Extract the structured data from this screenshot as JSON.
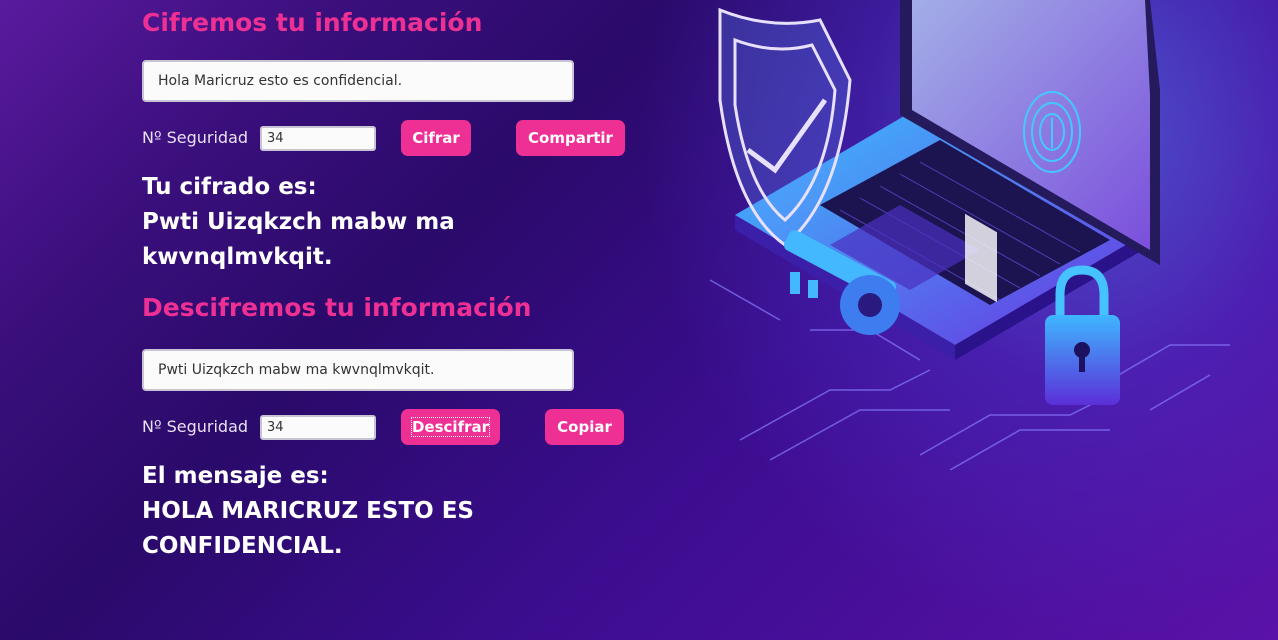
{
  "encrypt": {
    "heading": "Cifremos tu información",
    "message_value": "Hola Maricruz esto es confidencial.",
    "security_label": "Nº Seguridad",
    "security_value": "34",
    "encrypt_button": "Cifrar",
    "share_button": "Compartir",
    "result_title": "Tu cifrado es:",
    "result_text": "Pwti Uizqkzch mabw ma kwvnqlmvkqit."
  },
  "decrypt": {
    "heading": "Descifremos tu información",
    "message_value": "Pwti Uizqkzch mabw ma kwvnqlmvkqit.",
    "security_label": "Nº Seguridad",
    "security_value": "34",
    "decrypt_button": "Descifrar",
    "copy_button": "Copiar",
    "result_title": "El mensaje es:",
    "result_text": "HOLA MARICRUZ ESTO ES CONFIDENCIAL."
  },
  "illustration": {
    "icons": [
      "shield-check-icon",
      "laptop-icon",
      "fingerprint-icon",
      "key-icon",
      "padlock-icon"
    ],
    "colors": {
      "accent": "#ee2f94",
      "cyan": "#38c8ff",
      "violet": "#7a3cf0"
    }
  }
}
